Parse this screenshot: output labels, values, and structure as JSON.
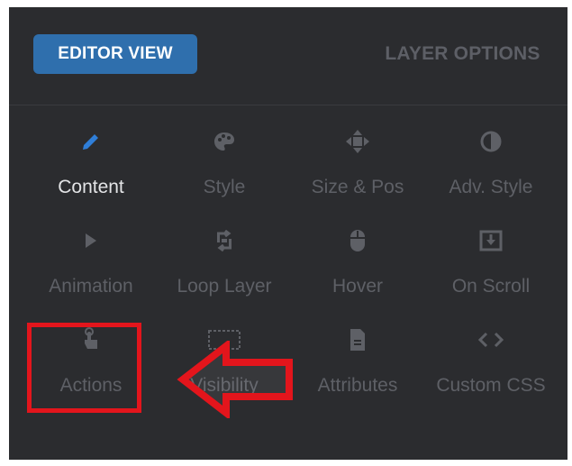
{
  "header": {
    "editor_view_label": "EDITOR VIEW",
    "layer_options_label": "LAYER OPTIONS"
  },
  "grid": {
    "items": [
      {
        "label": "Content",
        "icon": "pencil-icon"
      },
      {
        "label": "Style",
        "icon": "palette-icon"
      },
      {
        "label": "Size & Pos",
        "icon": "move-arrows-icon"
      },
      {
        "label": "Adv. Style",
        "icon": "contrast-icon"
      },
      {
        "label": "Animation",
        "icon": "play-icon"
      },
      {
        "label": "Loop Layer",
        "icon": "loop-icon"
      },
      {
        "label": "Hover",
        "icon": "mouse-icon"
      },
      {
        "label": "On Scroll",
        "icon": "scroll-download-icon"
      },
      {
        "label": "Actions",
        "icon": "pointer-hand-icon"
      },
      {
        "label": "Visibility",
        "icon": "visibility-icon"
      },
      {
        "label": "Attributes",
        "icon": "file-icon"
      },
      {
        "label": "Custom CSS",
        "icon": "code-brackets-icon"
      }
    ]
  },
  "colors": {
    "panel_bg": "#2b2c2f",
    "accent_blue": "#2f6fad",
    "annotation_red": "#e3151c"
  }
}
